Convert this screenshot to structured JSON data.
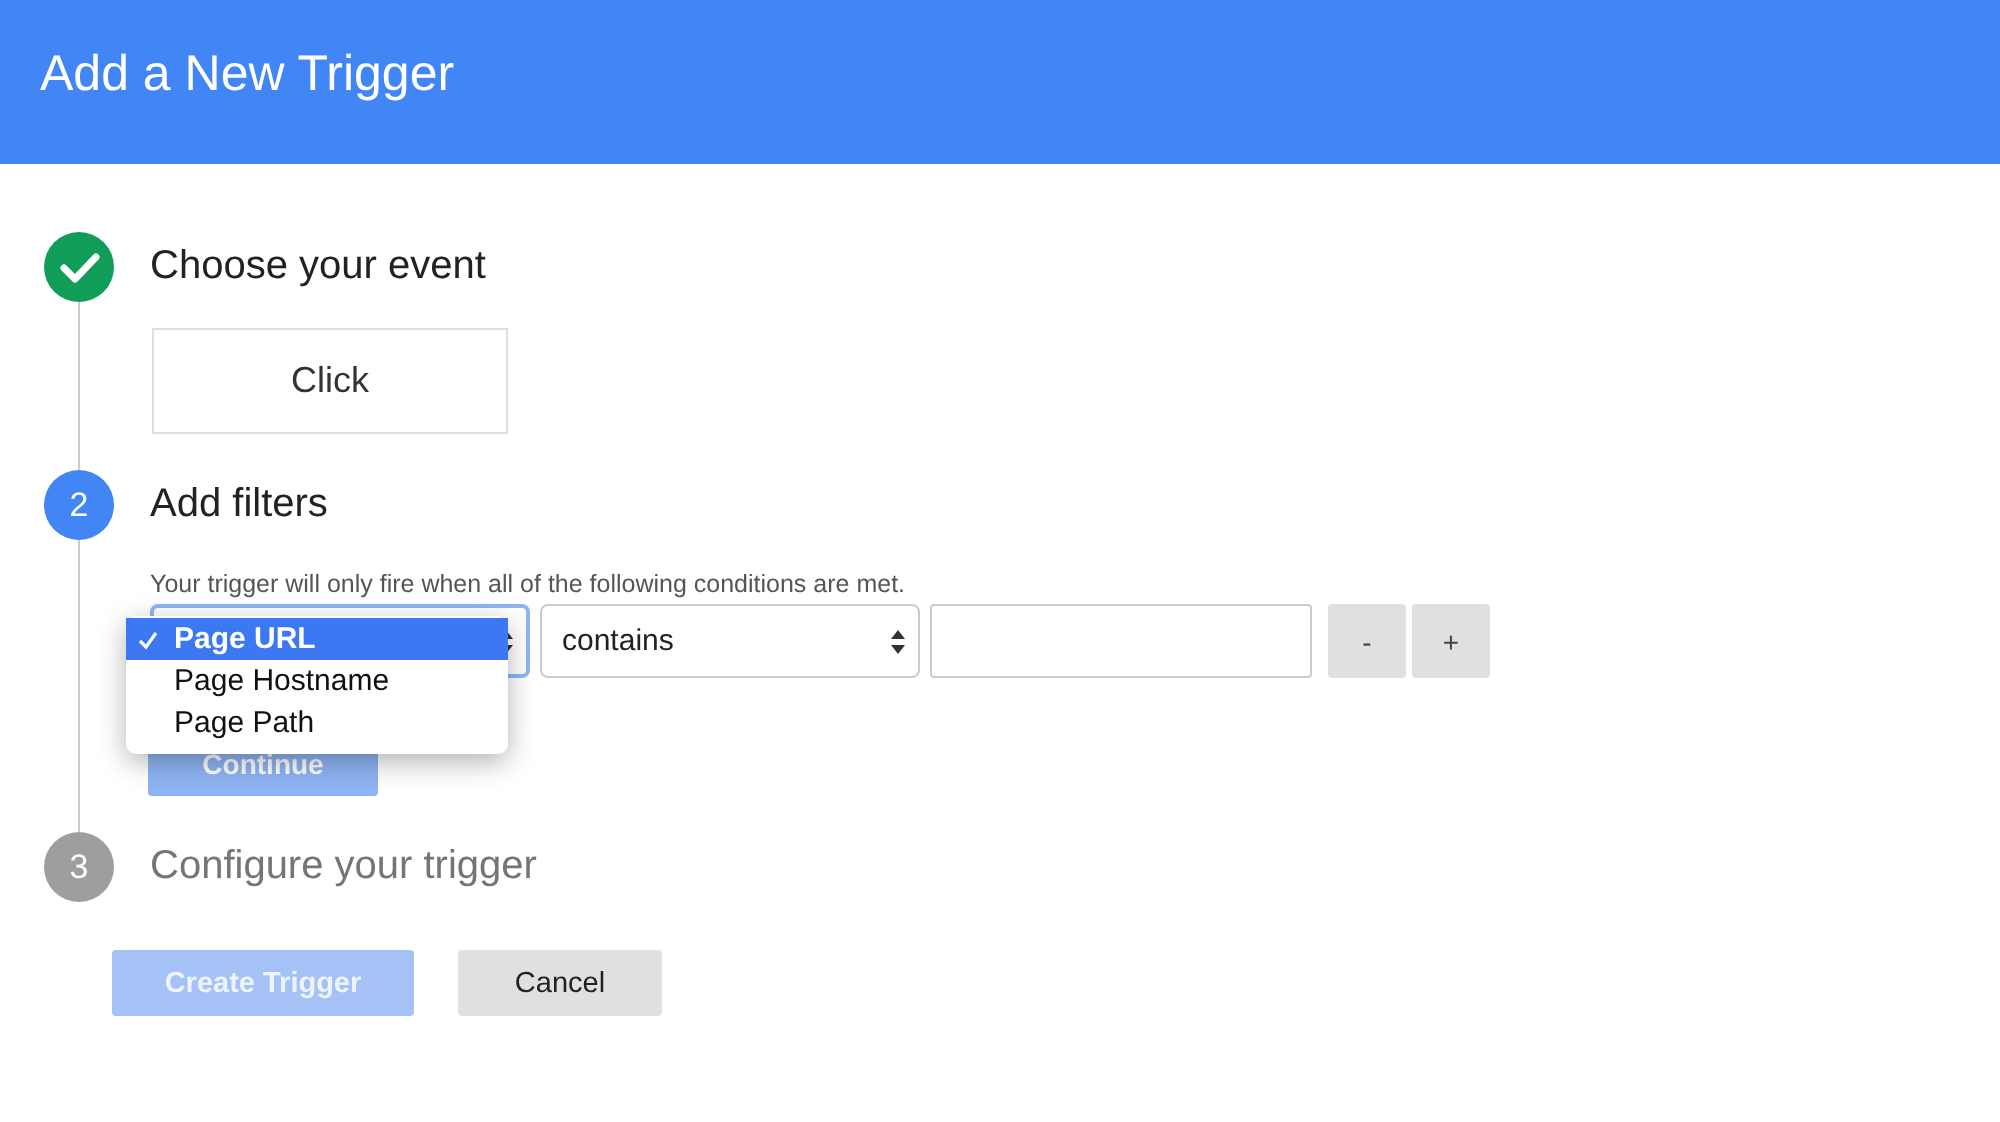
{
  "header": {
    "title": "Add a New Trigger"
  },
  "steps": [
    {
      "kind": "done",
      "title": "Choose your event",
      "event": "Click"
    },
    {
      "kind": "active",
      "number": "2",
      "title": "Add filters",
      "hint": "Your trigger will only fire when all of the following conditions are met.",
      "operator": "contains",
      "remove_button": "-",
      "add_button": "+",
      "continue_button": {
        "label": "Continue",
        "disabled": true
      },
      "dropdown": [
        {
          "label": "Page URL",
          "selected": true
        },
        {
          "label": "Page Hostname",
          "selected": false
        },
        {
          "label": "Page Path",
          "selected": false
        }
      ]
    },
    {
      "kind": "pending",
      "number": "3",
      "title": "Configure your trigger"
    }
  ],
  "footer": {
    "create_button": {
      "label": "Create Trigger",
      "disabled": true
    },
    "cancel_button": {
      "label": "Cancel",
      "disabled": false
    }
  }
}
